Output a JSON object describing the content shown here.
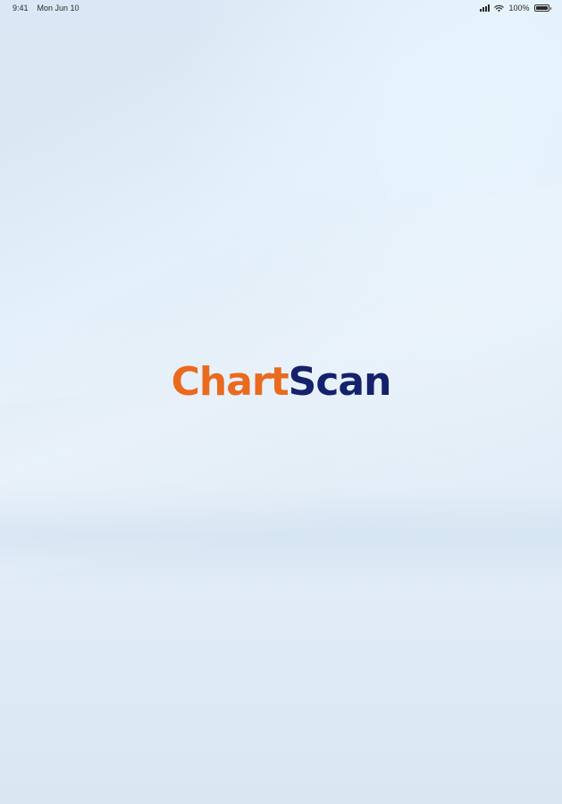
{
  "status_bar": {
    "time": "9:41",
    "date": "Mon Jun 10",
    "battery_percent": "100%",
    "battery_level": 1.0,
    "icons": [
      "cellular-signal-icon",
      "wifi-icon",
      "battery-icon"
    ]
  },
  "logo": {
    "part_1": "Chart",
    "part_2": "Scan",
    "colors": {
      "part_1": "#ea6a1e",
      "part_2": "#14216b"
    }
  },
  "background": {
    "colors": [
      "#d9e8f4",
      "#e2edf7",
      "#dae7f3"
    ]
  }
}
